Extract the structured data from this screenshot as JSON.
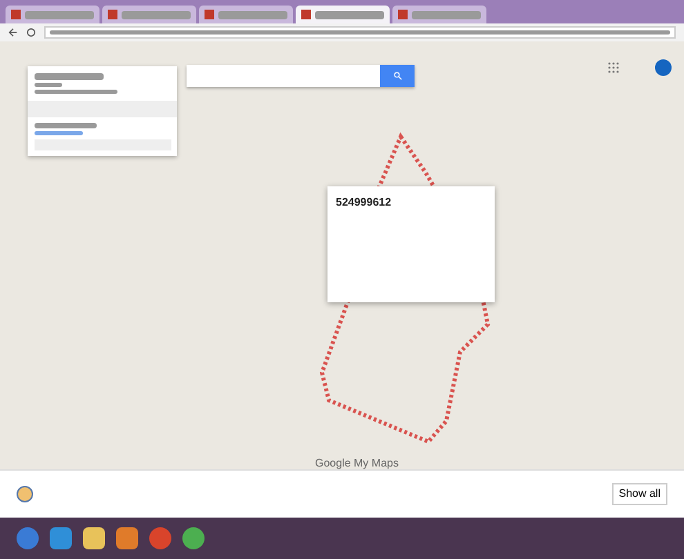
{
  "browser": {
    "tabs": [
      {
        "selected": false
      },
      {
        "selected": false
      },
      {
        "selected": false
      },
      {
        "selected": true
      },
      {
        "selected": false
      }
    ]
  },
  "map": {
    "popup": {
      "title": "524999612"
    },
    "logo": "Google My Maps"
  },
  "download_bar": {
    "button": "Show all"
  }
}
